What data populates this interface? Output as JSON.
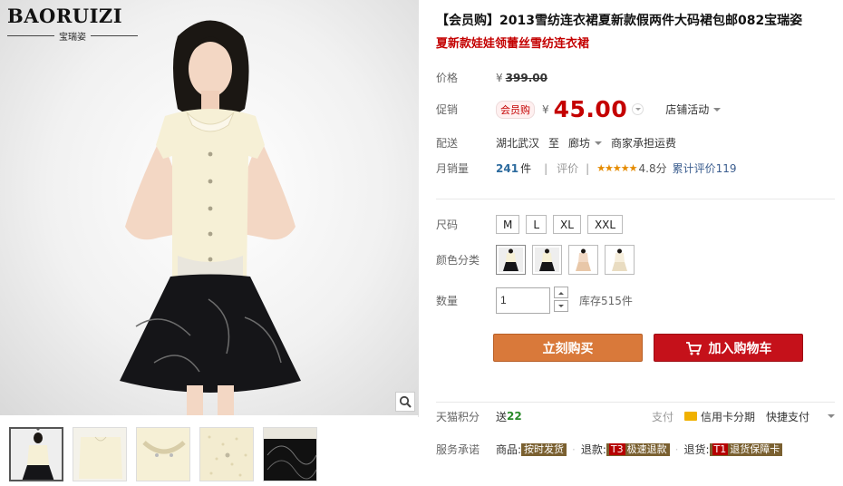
{
  "gallery": {
    "brand_name": "BAORUIZI",
    "brand_sub": "宝瑞姿",
    "thumbnails": [
      "thumb-1",
      "thumb-2",
      "thumb-3",
      "thumb-4",
      "thumb-5"
    ],
    "zoom_icon": "magnifier-icon"
  },
  "product": {
    "title": "【会员购】2013雪纺连衣裙夏新款假两件大码裙包邮082宝瑞姿",
    "subtitle": "夏新款娃娃领蕾丝雪纺连衣裙",
    "price_label": "价格",
    "currency": "¥",
    "original_price": "399.00",
    "promo_label": "促销",
    "vip_tag": "会员购",
    "promo_price": "45.00",
    "store_activity": "店铺活动",
    "delivery_label": "配送",
    "delivery_from": "湖北武汉",
    "delivery_to_word": "至",
    "delivery_to": "廊坊",
    "shipping_note": "商家承担运费",
    "sales_label": "月销量",
    "sales_count": "241",
    "sales_unit": "件",
    "review_label": "评价",
    "stars": "★★★★★",
    "rating": "4.8分",
    "review_count_text": "累计评价119"
  },
  "options": {
    "size_label": "尺码",
    "sizes": [
      "M",
      "L",
      "XL",
      "XXL"
    ],
    "color_label": "颜色分类",
    "quantity_label": "数量",
    "quantity_value": "1",
    "stock_text": "库存515件"
  },
  "actions": {
    "buy_now": "立刻购买",
    "add_to_cart": "加入购物车"
  },
  "footer": {
    "points_label": "天猫积分",
    "points_give": "送",
    "points_value": "22",
    "pay_label": "支付",
    "credit_installment": "信用卡分期",
    "quick_pay": "快捷支付",
    "promise_label": "服务承诺",
    "goods_label": "商品:",
    "goods_tag": "按时发货",
    "refund_label": "退款:",
    "refund_code": "T3",
    "refund_tag": "极速退款",
    "return_label": "退货:",
    "return_code": "T1",
    "return_tag": "退货保障卡"
  },
  "colors": {
    "price_red": "#c40000",
    "buy_orange": "#d9793a",
    "cart_red": "#c5111a",
    "link_blue": "#3c5e8f"
  }
}
